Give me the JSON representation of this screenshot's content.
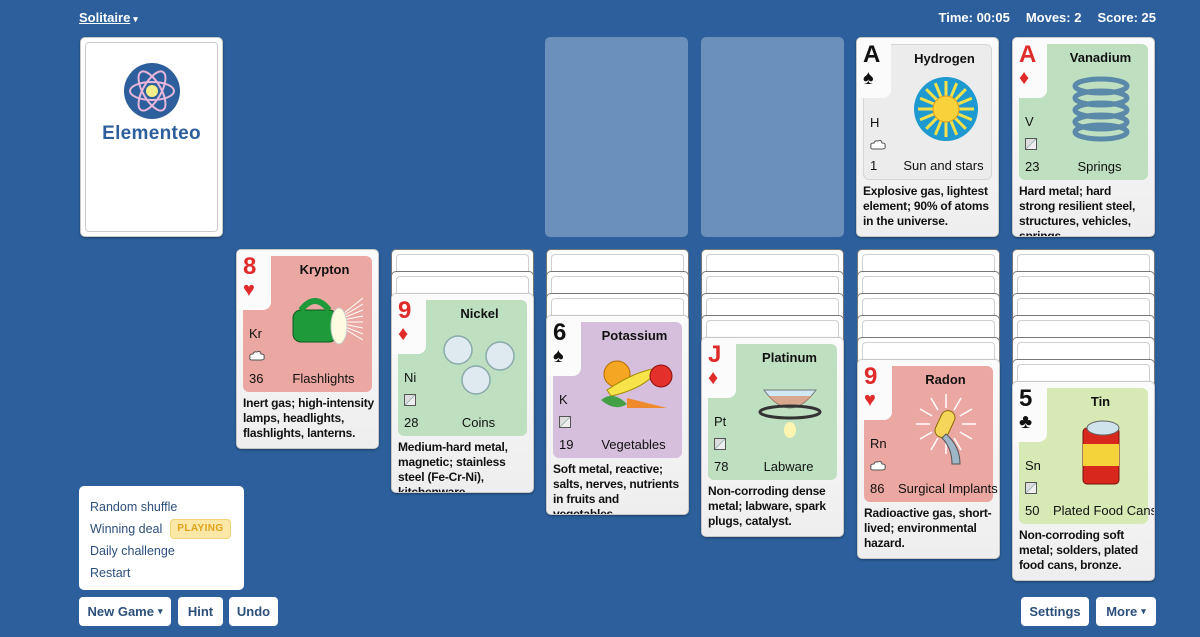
{
  "header": {
    "game_title": "Solitaire",
    "time_label": "Time: 00:05",
    "moves_label": "Moves: 2",
    "score_label": "Score: 25"
  },
  "stock": {
    "logo_text": "Elementeo"
  },
  "foundations": [
    {
      "empty": true
    },
    {
      "empty": true
    },
    {
      "rank": "A",
      "suit": "♠",
      "suit_name": "spades",
      "color": "black",
      "element": "Hydrogen",
      "symbol": "H",
      "state": "gas",
      "number": "1",
      "use": "Sun and stars",
      "theme": "gray",
      "description": "Explosive gas, lightest element; 90% of atoms in the universe."
    },
    {
      "rank": "A",
      "suit": "♦",
      "suit_name": "diamonds",
      "color": "red",
      "element": "Vanadium",
      "symbol": "V",
      "state": "solid",
      "number": "23",
      "use": "Springs",
      "theme": "green",
      "description": "Hard metal; hard strong resilient steel, structures, vehicles, springs."
    }
  ],
  "tableau": [
    {
      "face_down": 0,
      "card": {
        "rank": "8",
        "suit": "♥",
        "suit_name": "hearts",
        "color": "red",
        "element": "Krypton",
        "symbol": "Kr",
        "state": "gas",
        "number": "36",
        "use": "Flashlights",
        "theme": "red",
        "description": "Inert gas; high-intensity lamps, headlights, flashlights, lanterns."
      }
    },
    {
      "face_down": 2,
      "card": {
        "rank": "9",
        "suit": "♦",
        "suit_name": "diamonds",
        "color": "red",
        "element": "Nickel",
        "symbol": "Ni",
        "state": "solid",
        "number": "28",
        "use": "Coins",
        "theme": "green",
        "description": "Medium-hard metal, magnetic; stainless steel (Fe-Cr-Ni), kitchenware."
      }
    },
    {
      "face_down": 3,
      "card": {
        "rank": "6",
        "suit": "♠",
        "suit_name": "spades",
        "color": "black",
        "element": "Potassium",
        "symbol": "K",
        "state": "solid",
        "number": "19",
        "use": "Vegetables",
        "theme": "purple",
        "description": "Soft metal, reactive; salts, nerves, nutrients in fruits and vegetables."
      }
    },
    {
      "face_down": 4,
      "card": {
        "rank": "J",
        "suit": "♦",
        "suit_name": "diamonds",
        "color": "red",
        "element": "Platinum",
        "symbol": "Pt",
        "state": "solid",
        "number": "78",
        "use": "Labware",
        "theme": "green",
        "description": "Non-corroding dense metal; labware, spark plugs, catalyst."
      }
    },
    {
      "face_down": 5,
      "card": {
        "rank": "9",
        "suit": "♥",
        "suit_name": "hearts",
        "color": "red",
        "element": "Radon",
        "symbol": "Rn",
        "state": "gas",
        "number": "86",
        "use": "Surgical Implants",
        "theme": "red",
        "description": "Radioactive gas, short-lived; environmental hazard."
      }
    },
    {
      "face_down": 6,
      "card": {
        "rank": "5",
        "suit": "♣",
        "suit_name": "clubs",
        "color": "black",
        "element": "Tin",
        "symbol": "Sn",
        "state": "solid",
        "number": "50",
        "use": "Plated Food Cans",
        "theme": "lime",
        "description": "Non-corroding soft metal; solders, plated food cans, bronze."
      }
    }
  ],
  "new_game_menu": {
    "items": [
      {
        "label": "Random shuffle"
      },
      {
        "label": "Winning deal",
        "badge": "PLAYING"
      },
      {
        "label": "Daily challenge"
      },
      {
        "label": "Restart"
      }
    ]
  },
  "toolbar": {
    "new_game_label": "New Game",
    "hint_label": "Hint",
    "undo_label": "Undo",
    "settings_label": "Settings",
    "more_label": "More"
  },
  "icons": {
    "caret": "▾",
    "gas": "cloud-icon",
    "solid": "solid-block-icon"
  }
}
